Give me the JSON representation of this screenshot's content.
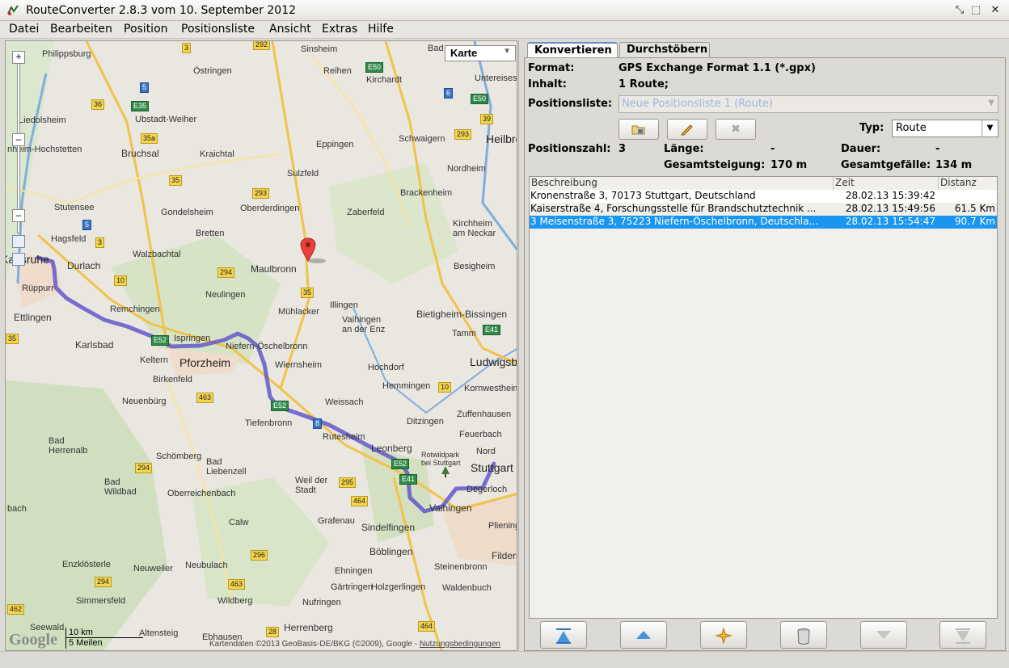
{
  "window": {
    "title": "RouteConverter 2.8.3 vom 10. September 2012",
    "app_icon": "routeconverter-icon",
    "controls": [
      "minimize-icon",
      "maximize-icon",
      "close-icon"
    ]
  },
  "menu": [
    "Datei",
    "Bearbeiten",
    "Position",
    "Positionsliste",
    "Ansicht",
    "Extras",
    "Hilfe"
  ],
  "map": {
    "type_select": "Karte",
    "scale_km": "10 km",
    "scale_mi": "5 Meilen",
    "copyright_prefix": "Kartendaten ©2013 GeoBasis-DE/BKG (©2009), Google - ",
    "copyright_link": "Nutzungsbedingungen",
    "logo": "Google",
    "places": [
      "Philippsburg",
      "Östringen",
      "Sinsheim",
      "Reihen",
      "Kirchardt",
      "Bad",
      "Untereisesheim",
      "Liedolsheim",
      "Ubstadt-Weiher",
      "Heilbronn",
      "Bruchsal",
      "Kraichtal",
      "Eppingen",
      "Schwaigern",
      "nheim-Hochstetten",
      "Sulzfeld",
      "Nordheim",
      "Brackenheim",
      "Stutensee",
      "Gondelsheim",
      "Oberderdingen",
      "Zaberfeld",
      "Kirchheim am Neckar",
      "Hagsfeld",
      "Bretten",
      "Karlsruhe",
      "Durlach",
      "Walzbachtal",
      "Maulbronn",
      "Besigheim",
      "Rüppurr",
      "Neulingen",
      "Mühlacker",
      "Illingen",
      "Bietigheim-Bissingen",
      "Ettlingen",
      "Remchingen",
      "Vaihingen an der Enz",
      "Tamm",
      "Karlsbad",
      "Ispringen",
      "Niefern-Öschelbronn",
      "Ludwigsburg",
      "Keltern",
      "Pforzheim",
      "Wiernsheim",
      "Hochdorf",
      "Birkenfeld",
      "Kornwestheim",
      "Neuenbürg",
      "Weissach",
      "Hemmingen",
      "Zuffenhausen",
      "Tiefenbronn",
      "Ditzingen",
      "Bad Herrenalb",
      "Rutesheim",
      "Feuerbach",
      "Leonberg",
      "Rotwildpark bei Stuttgart",
      "Nord",
      "Stuttgart",
      "Schömberg",
      "Bad Liebenzell",
      "Bad Wildbad",
      "Oberreichenbach",
      "Weil der Stadt",
      "Degerloch",
      "Vaihingen",
      "Grafenau",
      "Sindelfingen",
      "Calw",
      "Plieningen",
      "Böblingen",
      "Filderstadt",
      "Enzklösterle",
      "Neuweiler",
      "Neubulach",
      "Ehningen",
      "Steinenbronn",
      "Gärtringen",
      "Holzgerlingen",
      "Waldenbuch",
      "Simmersfeld",
      "Wildberg",
      "Nufringen",
      "Seewald",
      "Altensteig",
      "Herrenberg",
      "Ebhausen",
      "bach"
    ],
    "road_shields": [
      "3",
      "292",
      "E50",
      "5",
      "36",
      "E35",
      "6",
      "E50",
      "39",
      "35a",
      "293",
      "35",
      "293",
      "5",
      "3",
      "294",
      "10",
      "35",
      "E52",
      "E41",
      "463",
      "E52",
      "8",
      "10",
      "E52",
      "E41",
      "294",
      "295",
      "464",
      "296",
      "294",
      "463",
      "462",
      "28",
      "464",
      "35"
    ]
  },
  "tabs": [
    "Konvertieren",
    "Durchstöbern"
  ],
  "info": {
    "format_label": "Format:",
    "format_value": "GPS Exchange Format 1.1 (*.gpx)",
    "inhalt_label": "Inhalt:",
    "inhalt_value": "1 Route;",
    "positionsliste_label": "Positionsliste:",
    "positionsliste_value": "Neue Positionsliste 1 (Route)",
    "typ_label": "Typ:",
    "typ_value": "Route",
    "positionszahl_label": "Positionszahl:",
    "positionszahl_value": "3",
    "laenge_label": "Länge:",
    "laenge_value": "-",
    "dauer_label": "Dauer:",
    "dauer_value": "-",
    "steigung_label": "Gesamtsteigung:",
    "steigung_value": "170 m",
    "gefaelle_label": "Gesamtgefälle:",
    "gefaelle_value": "134 m"
  },
  "table": {
    "headers": [
      "Beschreibung",
      "Zeit",
      "Distanz"
    ],
    "rows": [
      {
        "beschreibung": "Kronenstraße 3, 70173 Stuttgart, Deutschland",
        "zeit": "28.02.13 15:39:42",
        "distanz": ""
      },
      {
        "beschreibung": "Kaiserstraße 4, Forschungsstelle für Brandschutztechnik ...",
        "zeit": "28.02.13 15:49:56",
        "distanz": "61.5 Km"
      },
      {
        "beschreibung": "3 Meisenstraße 3, 75223 Niefern-Öschelbronn, Deutschla...",
        "zeit": "28.02.13 15:54:47",
        "distanz": "90.7 Km"
      }
    ],
    "selected_row": 2
  },
  "colors": {
    "route": "#5a4fc8",
    "selection": "#1a96f0",
    "tab_accent": "#6a8fc8"
  }
}
